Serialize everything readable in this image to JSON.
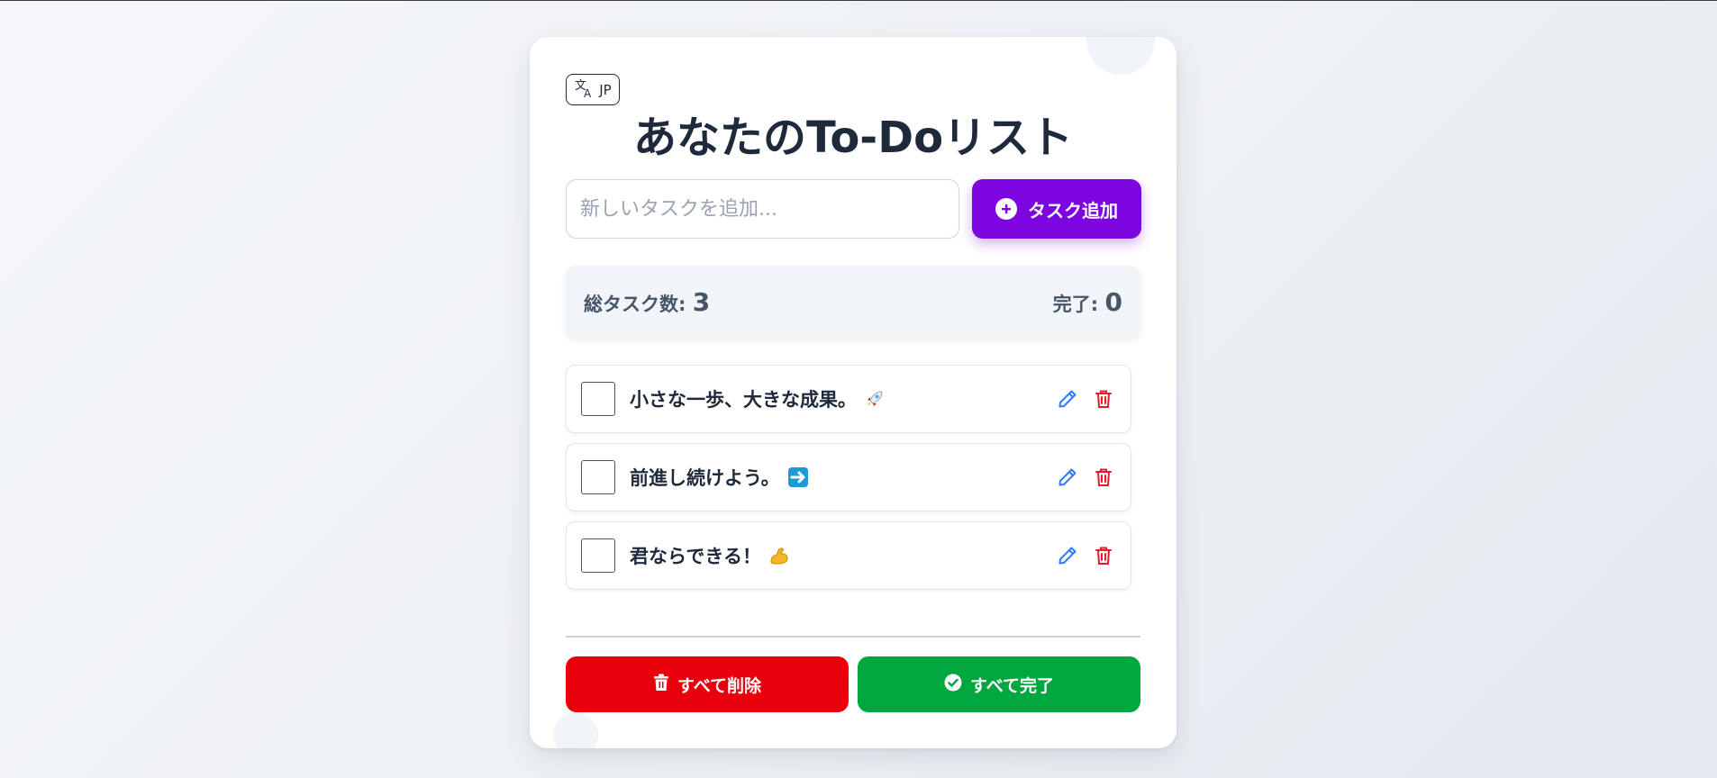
{
  "app": {
    "title": "あなたのTo-Doリスト",
    "language_label": "JP"
  },
  "input": {
    "placeholder": "新しいタスクを追加...",
    "value": ""
  },
  "add_button": {
    "label": "タスク追加",
    "icon": "plus-circle-icon",
    "color": "#7c05e0"
  },
  "stats": {
    "total_label": "総タスク数:",
    "total_value": "3",
    "done_label": "完了:",
    "done_value": "0"
  },
  "tasks": [
    {
      "text": "小さな一歩、大きな成果。",
      "emoji": "rocket-emoji",
      "checked": false
    },
    {
      "text": "前進し続けよう。",
      "emoji": "right-arrow-emoji",
      "checked": false
    },
    {
      "text": "君ならできる！",
      "emoji": "flexed-biceps-emoji",
      "checked": false
    }
  ],
  "bottom_buttons": {
    "delete_all_label": "すべて削除",
    "delete_all_color": "#e8000d",
    "complete_all_label": "すべて完了",
    "complete_all_color": "#00a63e"
  },
  "icons": {
    "edit": "pencil-icon",
    "delete": "trash-icon",
    "edit_color": "#2f7bf5",
    "delete_color": "#e11d2e"
  }
}
